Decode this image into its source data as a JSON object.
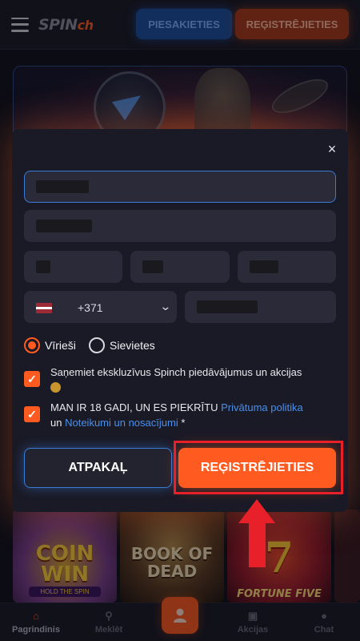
{
  "header": {
    "logo_main": "SPIN",
    "logo_accent": "ch",
    "login_label": "PIESAKIETIES",
    "register_label": "REĢISTRĒJIETIES"
  },
  "games": [
    {
      "title": "COIN WIN",
      "subtitle": "HOLD THE SPIN"
    },
    {
      "title": "BOOK OF DEAD"
    },
    {
      "title": "FORTUNE FIVE",
      "symbol": "7"
    }
  ],
  "bottom_nav": {
    "home": "Pagrindinis",
    "search": "Meklēt",
    "promos": "Akcijas",
    "chat": "Chat"
  },
  "modal": {
    "close_icon": "×",
    "phone_code": "+371",
    "country_flag": "latvia-flag",
    "gender": {
      "male": "Vīrieši",
      "female": "Sievietes",
      "selected": "male"
    },
    "offers_consent": {
      "checked": true,
      "text": "Saņemiet ekskluzīvus Spinch piedāvājumus un akcijas"
    },
    "terms_consent": {
      "checked": true,
      "prefix": "MAN IR 18 GADI, UN ES PIEKRĪTU",
      "privacy_link": "Privātuma politika",
      "joiner": "un",
      "terms_link": "Noteikumi un nosacījumi",
      "required_mark": "*"
    },
    "back_label": "ATPAKAĻ",
    "submit_label": "REĢISTRĒJIETIES"
  },
  "colors": {
    "accent": "#ff5a1f",
    "link": "#4a8fe8",
    "annotation": "#e8202a",
    "background": "#12121c"
  }
}
